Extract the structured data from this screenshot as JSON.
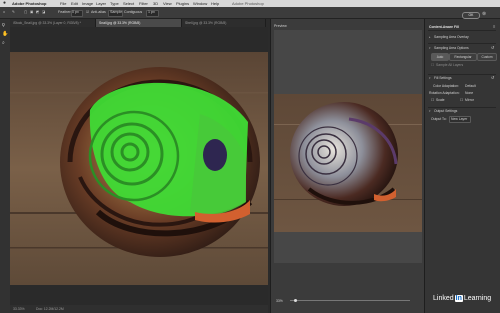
{
  "menubar": {
    "app_name": "Adobe Photoshop",
    "items": [
      "File",
      "Edit",
      "Image",
      "Layer",
      "Type",
      "Select",
      "Filter",
      "3D",
      "View",
      "Plugins",
      "Window",
      "Help"
    ],
    "window_title": "Adobe Photoshop"
  },
  "options": {
    "feather_label": "Feather:",
    "feather_value": "0 px",
    "antialias_label": "Anti-alias",
    "sample_label": "Sample",
    "contiguous_label": "Contiguous",
    "tolerance_value": "1 px"
  },
  "tabs": [
    {
      "label": "iStock_Snail.jpg @ 33.3% (Layer 0, RGB/8) *"
    },
    {
      "label": "Snail.jpg @ 33.3% (RGB/8)",
      "active": true
    },
    {
      "label": "Shell.jpg @ 33.3% (RGB/8)"
    }
  ],
  "statusbar": {
    "zoom": "33.33%",
    "doc_info": "Doc: 12.2M/12.2M"
  },
  "preview": {
    "title": "Preview",
    "zoom": "33%"
  },
  "ok_label": "OK",
  "props": {
    "title": "Content-Aware Fill",
    "sampling_overlay": "Sampling Area Overlay",
    "sampling_options": "Sampling Area Options",
    "btn_auto": "Auto",
    "btn_rect": "Rectangular",
    "btn_custom": "Custom",
    "sample_all_layers": "Sample All Layers",
    "fill_settings": "Fill Settings",
    "color_adapt_label": "Color Adaptation:",
    "color_adapt_value": "Default",
    "rotation_label": "Rotation Adaptation:",
    "rotation_value": "None",
    "scale_label": "Scale",
    "mirror_label": "Mirror",
    "output_settings": "Output Settings",
    "output_to_label": "Output To:",
    "output_to_value": "New Layer"
  },
  "watermark": {
    "part1": "Linked",
    "part2": "In",
    "part3": "Learning"
  },
  "colors": {
    "overlay_green": "#3fdb35",
    "panel_bg": "#353535"
  }
}
